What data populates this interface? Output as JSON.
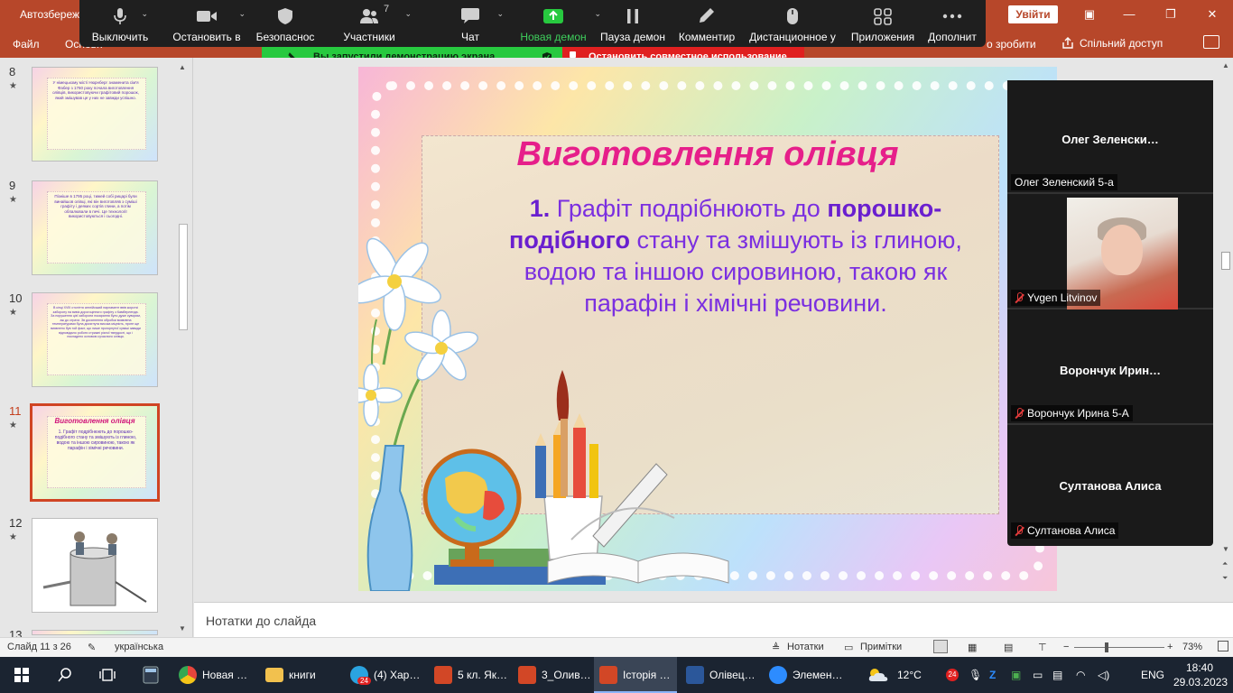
{
  "ppt": {
    "autosave_label": "Автозбереж",
    "exit_button": "Увійти",
    "tabs": [
      "Файл",
      "Основн"
    ],
    "tell_me_tail": "о зробити",
    "share_label": "Спільний доступ"
  },
  "zoom_toolbar": {
    "items": [
      {
        "label": "Выключить",
        "icon": "microphone-icon"
      },
      {
        "label": "Остановить в",
        "icon": "video-camera-icon"
      },
      {
        "label": "Безопаснос",
        "icon": "shield-icon"
      },
      {
        "label": "Участники",
        "icon": "participants-icon",
        "count": "7"
      },
      {
        "label": "Чат",
        "icon": "chat-icon"
      },
      {
        "label": "Новая демон",
        "icon": "share-screen-icon"
      },
      {
        "label": "Пауза демон",
        "icon": "pause-icon"
      },
      {
        "label": "Комментир",
        "icon": "pencil-icon"
      },
      {
        "label": "Дистанционное у",
        "icon": "mouse-icon"
      },
      {
        "label": "Приложения",
        "icon": "apps-icon"
      },
      {
        "label": "Дополнит",
        "icon": "more-icon"
      }
    ],
    "share_banner": "Вы запустили демонстрацию экрана",
    "stop_banner": "Остановить совместное использование",
    "accent_green": "#27c93f",
    "accent_red": "#e02020"
  },
  "slides_panel": {
    "slides": [
      {
        "number": "8",
        "text": "У німецькому місті Нюрнберг знаменита сім'я Фабер з 1760 року почала виготовлення олівців, використовуючи графітовий порошок, який змішував це у них не завжди успішно."
      },
      {
        "number": "9",
        "text": "Пізніше в 1795 році, тижей собі рицарі були винайшов олівці, які він виготовляв з суміші графіту і деяких сортів глини, а потім обпалювали в печі. Це технології використовуються і сьогодні."
      },
      {
        "number": "10",
        "text": "В кінці XVIII століття англійський парламент ввів жорсткі заборону на вивіз дорогоцінного графіту з Камберленда. За порушення цієї заборони покарання було дуже суворим, аж до страти. Зв досягнення обробки виявлена температурами була досягнута висока міцність, проте ще виявлено був той факт, що лише прогорнутої суміші завжди відповідало роботи стрижні різної твердості, що і покладено основою сучасного олівця."
      },
      {
        "number": "11",
        "title": "Виготовлення олівця",
        "text": "1. Графіт подрібнюють до порошко-подібного стану та змішують із глиною, водою та іншою сировиною, такою як парафін і хімічні речовини."
      },
      {
        "number": "12",
        "text": ""
      },
      {
        "number": "13",
        "text": ""
      }
    ]
  },
  "slide": {
    "title": "Виготовлення олівця",
    "num": "1.",
    "body_a": "Графіт подрібнюють до",
    "body_b": "порошко-",
    "body_c": "подібного",
    "body_d": "стану та змішують із глиною, водою та іншою сировиною, такою як парафін і хімічні речовини.",
    "title_color": "#e61f8a",
    "body_color": "#7b2fe0"
  },
  "gallery": {
    "tiles": [
      {
        "big_name": "Олег  Зеленски…",
        "tag": "Олег Зеленский 5-а",
        "muted": false,
        "video": false
      },
      {
        "big_name": "",
        "tag": "Yvgen Litvinov",
        "muted": true,
        "video": true
      },
      {
        "big_name": "Ворончук  Ирин…",
        "tag": "Ворончук Ирина 5-А",
        "muted": true,
        "video": false
      },
      {
        "big_name": "Султанова Алиса",
        "tag": "Султанова Алиса",
        "muted": true,
        "video": false
      }
    ]
  },
  "notes": {
    "placeholder": "Нотатки до слайда"
  },
  "status": {
    "slide_of": "Слайд 11 з 26",
    "language": "українська",
    "notes_btn": "Нотатки",
    "comments_btn": "Примітки",
    "zoom_minus": "−",
    "zoom_plus": "+",
    "zoom_level": "73%"
  },
  "taskbar": {
    "apps": [
      {
        "label": "Новая …",
        "icon": "chrome-icon",
        "color": "#e8453c"
      },
      {
        "label": "книги",
        "icon": "folder-icon",
        "color": "#f2c14e"
      },
      {
        "label": "(4) Хар…",
        "icon": "telegram-icon",
        "color": "#2aa3e0"
      },
      {
        "label": "5 кл. Як…",
        "icon": "powerpoint-icon",
        "color": "#d24726"
      },
      {
        "label": "3_Олив…",
        "icon": "powerpoint-icon",
        "color": "#d24726"
      },
      {
        "label": "Історія …",
        "icon": "powerpoint-icon",
        "color": "#d24726"
      },
      {
        "label": "Олівец…",
        "icon": "word-icon",
        "color": "#2b579a"
      },
      {
        "label": "Элемен…",
        "icon": "zoom-icon",
        "color": "#2d8cff"
      }
    ],
    "badge": "24",
    "temperature": "12°C",
    "lang": "ENG",
    "time": "18:40",
    "date": "29.03.2023"
  }
}
